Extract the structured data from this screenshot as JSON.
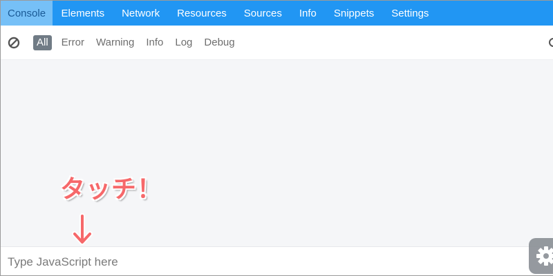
{
  "tabs": [
    {
      "label": "Console",
      "active": true
    },
    {
      "label": "Elements"
    },
    {
      "label": "Network"
    },
    {
      "label": "Resources"
    },
    {
      "label": "Sources"
    },
    {
      "label": "Info"
    },
    {
      "label": "Snippets"
    },
    {
      "label": "Settings"
    }
  ],
  "filters": [
    {
      "label": "All",
      "active": true
    },
    {
      "label": "Error"
    },
    {
      "label": "Warning"
    },
    {
      "label": "Info"
    },
    {
      "label": "Log"
    },
    {
      "label": "Debug"
    }
  ],
  "annotation": {
    "text": "タッチ！"
  },
  "console_input": {
    "placeholder": "Type JavaScript here"
  },
  "icons": {
    "clear": "clear-console-icon",
    "settings": "gear-icon",
    "arrow": "down-arrow-icon"
  },
  "colors": {
    "accent": "#2196f3",
    "active_tab": "#76c0f7",
    "active_filter": "#707b85",
    "annotation": "#f6686a"
  }
}
